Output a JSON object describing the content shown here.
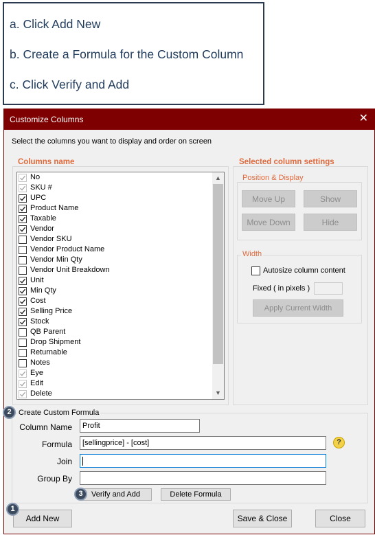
{
  "instructions": [
    "a. Click Add New",
    "b. Create a Formula for the Custom Column",
    "c. Click Verify and Add"
  ],
  "dialog": {
    "title": "Customize Columns",
    "subtitle": "Select the columns you want to display and order on screen",
    "columns_header": "Columns name",
    "columns": [
      {
        "label": "No",
        "checked": true,
        "enabled": false
      },
      {
        "label": "SKU #",
        "checked": true,
        "enabled": false
      },
      {
        "label": "UPC",
        "checked": true,
        "enabled": true
      },
      {
        "label": "Product Name",
        "checked": true,
        "enabled": true
      },
      {
        "label": "Taxable",
        "checked": true,
        "enabled": true
      },
      {
        "label": "Vendor",
        "checked": true,
        "enabled": true
      },
      {
        "label": "Vendor SKU",
        "checked": false,
        "enabled": true
      },
      {
        "label": "Vendor Product Name",
        "checked": false,
        "enabled": true
      },
      {
        "label": "Vendor Min Qty",
        "checked": false,
        "enabled": true
      },
      {
        "label": "Vendor Unit Breakdown",
        "checked": false,
        "enabled": true
      },
      {
        "label": "Unit",
        "checked": true,
        "enabled": true
      },
      {
        "label": "Min Qty",
        "checked": true,
        "enabled": true
      },
      {
        "label": "Cost",
        "checked": true,
        "enabled": true
      },
      {
        "label": "Selling Price",
        "checked": true,
        "enabled": true
      },
      {
        "label": "Stock",
        "checked": true,
        "enabled": true
      },
      {
        "label": "QB Parent",
        "checked": false,
        "enabled": true
      },
      {
        "label": "Drop Shipment",
        "checked": false,
        "enabled": true
      },
      {
        "label": "Returnable",
        "checked": false,
        "enabled": true
      },
      {
        "label": "Notes",
        "checked": false,
        "enabled": true
      },
      {
        "label": "Eye",
        "checked": true,
        "enabled": false
      },
      {
        "label": "Edit",
        "checked": true,
        "enabled": false
      },
      {
        "label": "Delete",
        "checked": true,
        "enabled": false
      }
    ],
    "settings": {
      "header": "Selected column settings",
      "position_group": "Position & Display",
      "move_up": "Move Up",
      "show": "Show",
      "move_down": "Move Down",
      "hide": "Hide",
      "width_group": "Width",
      "autosize_label": "Autosize column content",
      "fixed_label": "Fixed ( in pixels )",
      "apply_width": "Apply Current Width"
    },
    "custom_formula": {
      "group": "Create Custom Formula",
      "column_name_label": "Column Name",
      "column_name_value": "Profit",
      "formula_label": "Formula",
      "formula_value": "[sellingprice] - [cost]",
      "join_label": "Join",
      "join_value": "",
      "group_by_label": "Group By",
      "group_by_value": "",
      "help_glyph": "?",
      "verify_add": "Verify and Add",
      "delete_formula": "Delete Formula"
    },
    "footer": {
      "add_new": "Add New",
      "save_close": "Save & Close",
      "close": "Close"
    },
    "markers": [
      "1",
      "2",
      "3"
    ],
    "close_glyph": "✕"
  }
}
